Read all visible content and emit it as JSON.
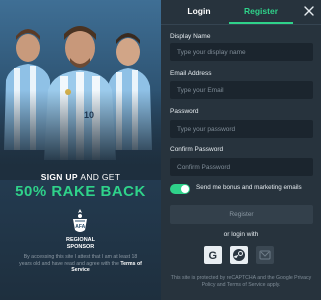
{
  "promo": {
    "headline_part1": "SIGN UP",
    "headline_part2": "AND GET",
    "headline_big": "50% RAKE BACK",
    "sponsor_line1": "REGIONAL",
    "sponsor_line2": "SPONSOR",
    "disclaimer_text": "By accessing this site I attest that I am at least 18 years old and have read and agree with the",
    "disclaimer_link": "Terms of Service",
    "brand_green": "#2fd28a"
  },
  "tabs": {
    "login_label": "Login",
    "register_label": "Register",
    "active": "Register"
  },
  "form": {
    "display_name_label": "Display Name",
    "display_name_placeholder": "Type your display name",
    "email_label": "Email Address",
    "email_placeholder": "Type your Email",
    "password_label": "Password",
    "password_placeholder": "Type your password",
    "confirm_label": "Confirm Password",
    "confirm_placeholder": "Confirm Password",
    "bonus_label": "Send me bonus and marketing emails",
    "bonus_enabled": true,
    "register_button": "Register",
    "or_login_with": "or login with",
    "recaptcha_text": "This site is protected by reCAPTCHA and the Google Privacy Policy and Terms of Service apply."
  },
  "social": [
    {
      "name": "google-icon"
    },
    {
      "name": "steam-icon"
    },
    {
      "name": "third-party-icon"
    }
  ],
  "colors": {
    "panel_bg": "#27333d",
    "input_bg": "#1b252e",
    "accent": "#2fd28a"
  }
}
